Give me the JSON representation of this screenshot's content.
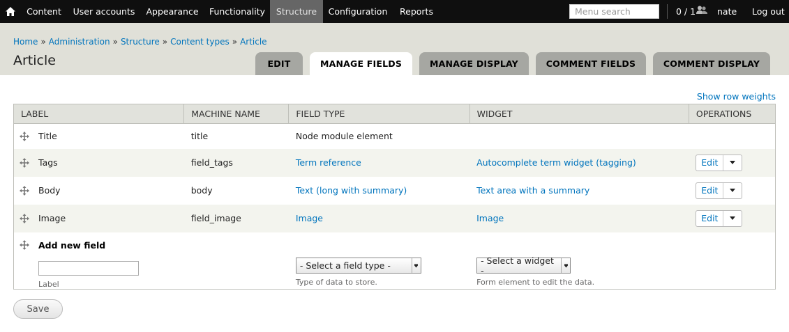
{
  "toolbar": {
    "home_icon": "home-icon",
    "items": [
      {
        "label": "Content",
        "active": false
      },
      {
        "label": "User accounts",
        "active": false
      },
      {
        "label": "Appearance",
        "active": false
      },
      {
        "label": "Functionality",
        "active": false
      },
      {
        "label": "Structure",
        "active": true
      },
      {
        "label": "Configuration",
        "active": false
      },
      {
        "label": "Reports",
        "active": false
      }
    ],
    "search_placeholder": "Menu search",
    "user_count": "0 / 1",
    "user_count_icon": "users-icon",
    "username": "nate",
    "logout": "Log out"
  },
  "breadcrumb": [
    "Home",
    "Administration",
    "Structure",
    "Content types",
    "Article"
  ],
  "page_title": "Article",
  "tabs": [
    {
      "label": "EDIT",
      "active": false
    },
    {
      "label": "MANAGE FIELDS",
      "active": true
    },
    {
      "label": "MANAGE DISPLAY",
      "active": false
    },
    {
      "label": "COMMENT FIELDS",
      "active": false
    },
    {
      "label": "COMMENT DISPLAY",
      "active": false
    }
  ],
  "show_row_weights": "Show row weights",
  "table": {
    "headers": [
      "LABEL",
      "MACHINE NAME",
      "FIELD TYPE",
      "WIDGET",
      "OPERATIONS"
    ],
    "rows": [
      {
        "label": "Title",
        "machine_name": "title",
        "field_type": "Node module element",
        "widget": "",
        "operation": ""
      },
      {
        "label": "Tags",
        "machine_name": "field_tags",
        "field_type": "Term reference",
        "widget": "Autocomplete term widget (tagging)",
        "operation": "Edit"
      },
      {
        "label": "Body",
        "machine_name": "body",
        "field_type": "Text (long with summary)",
        "widget": "Text area with a summary",
        "operation": "Edit"
      },
      {
        "label": "Image",
        "machine_name": "field_image",
        "field_type": "Image",
        "widget": "Image",
        "operation": "Edit"
      }
    ],
    "add_new": {
      "title": "Add new field",
      "label_value": "",
      "label_desc": "Label",
      "field_type_select": "- Select a field type -",
      "field_type_desc": "Type of data to store.",
      "widget_select": "- Select a widget -",
      "widget_desc": "Form element to edit the data."
    }
  },
  "save_label": "Save",
  "colors": {
    "toolbar_bg": "#0f0f0f",
    "toolbar_active": "#666666",
    "header_bg": "#e0e0d8",
    "tab_bg": "#a6a7a2",
    "link": "#0074bd"
  }
}
